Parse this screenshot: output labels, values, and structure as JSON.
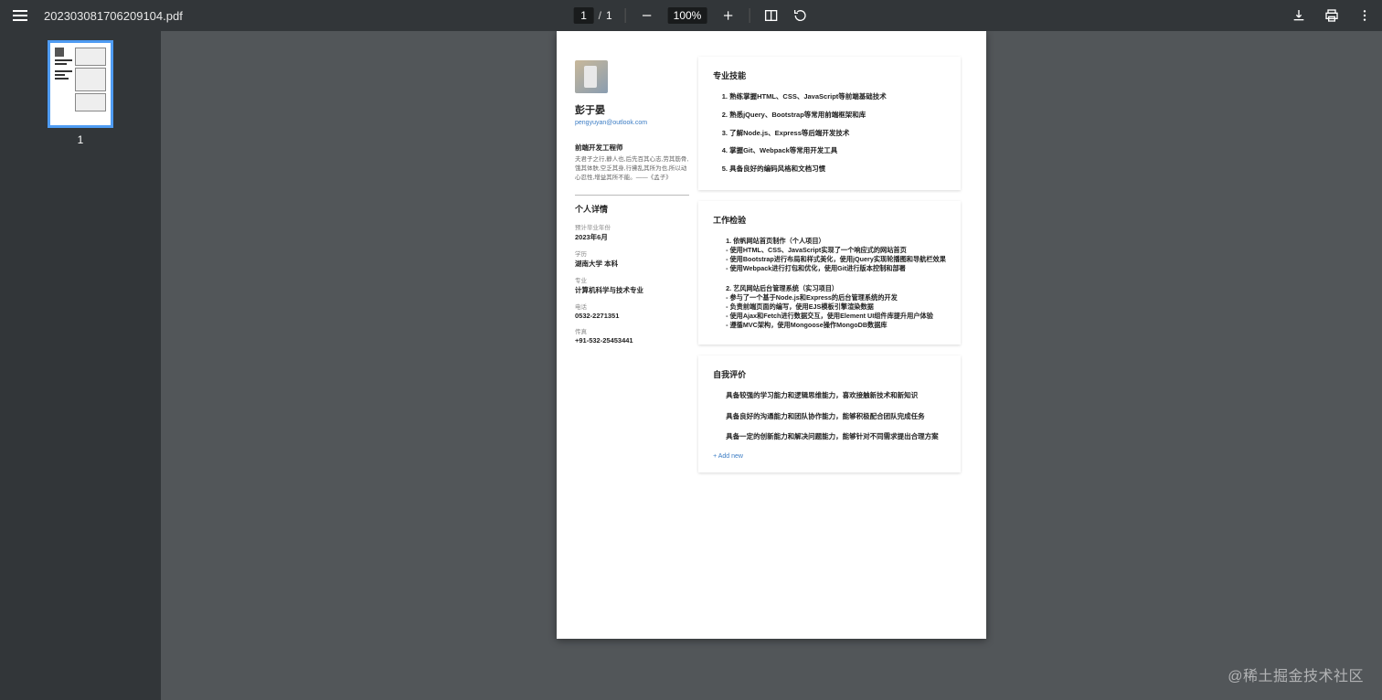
{
  "toolbar": {
    "filename": "20230308170620​9104.pdf",
    "current_page": "1",
    "page_separator": "/",
    "total_pages": "1",
    "zoom_level": "100%"
  },
  "sidebar": {
    "thumb_number": "1"
  },
  "resume": {
    "name": "彭于晏",
    "email": "pengyuyan@outlook.com",
    "job_title": "前端开发工程师",
    "motto": "夫君子之行,静人也,后先百其心志,劳其筋骨,饿其体肤,空乏其身,行拂乱其所为也,所以动心忍性,增益其所不能。——《孟子》",
    "details_title": "个人详情",
    "details": {
      "grad_label": "预计毕业年份",
      "grad_value": "2023年6月",
      "school_label": "学历",
      "school_value": "湖南大学 本科",
      "major_label": "专业",
      "major_value": "计算机科学与技术专业",
      "phone_label": "电话",
      "phone_value": "0532-2271351",
      "fax_label": "传真",
      "fax_value": "+91-532-25453441"
    },
    "skills_title": "专业技能",
    "skills": [
      "熟练掌握HTML、CSS、JavaScript等前端基础技术",
      "熟悉jQuery、Bootstrap等常用前端框架和库",
      "了解Node.js、Express等后端开发技术",
      "掌握Git、Webpack等常用开发工具",
      "具备良好的编码风格和文档习惯"
    ],
    "exp_title": "工作检验",
    "exp": [
      {
        "title": "1. 依帆网站首页制作（个人项目）",
        "lines": [
          "- 使用HTML、CSS、JavaScript实现了一个响应式的网站首页",
          "- 使用Bootstrap进行布局和样式美化，使用jQuery实现轮播图和导航栏效果",
          "- 使用Webpack进行打包和优化，使用Git进行版本控制和部署"
        ]
      },
      {
        "title": "2. 艺风网站后台管理系统（实习项目）",
        "lines": [
          "- 参与了一个基于Node.js和Express的后台管理系统的开发",
          "- 负责前端页面的编写，使用EJS模板引擎渲染数据",
          "- 使用Ajax和Fetch进行数据交互，使用Element UI组件库提升用户体验",
          "- 遵循MVC架构，使用Mongoose操作MongoDB数据库"
        ]
      }
    ],
    "eval_title": "自我评价",
    "eval": [
      "具备较强的学习能力和逻辑思维能力，喜欢接触新技术和新知识",
      "具备良好的沟通能力和团队协作能力，能够积极配合团队完成任务",
      "具备一定的创新能力和解决问题能力，能够针对不同需求提出合理方案"
    ],
    "add_new": "+ Add new"
  },
  "watermark": "@稀土掘金技术社区"
}
